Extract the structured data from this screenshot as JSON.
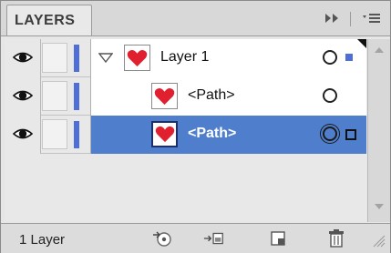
{
  "panel": {
    "tab_label": "LAYERS",
    "menu_icon": "panel-menu-icon",
    "collapse_icon": "double-arrow-icon"
  },
  "layers": [
    {
      "name": "Layer 1",
      "type": "layer",
      "expanded": true,
      "selected": false,
      "color": "#4f6fd8"
    },
    {
      "name": "<Path>",
      "type": "path",
      "selected": false
    },
    {
      "name": "<Path>",
      "type": "path",
      "selected": true
    }
  ],
  "footer": {
    "count_label": "1 Layer",
    "icons": [
      "locate-object-icon",
      "make-clipping-mask-icon",
      "new-sublayer-icon",
      "new-layer-icon",
      "delete-icon"
    ]
  },
  "colors": {
    "selection": "#4f7fcc",
    "layer_color": "#4f6fd8",
    "heart": "#e0202e"
  }
}
